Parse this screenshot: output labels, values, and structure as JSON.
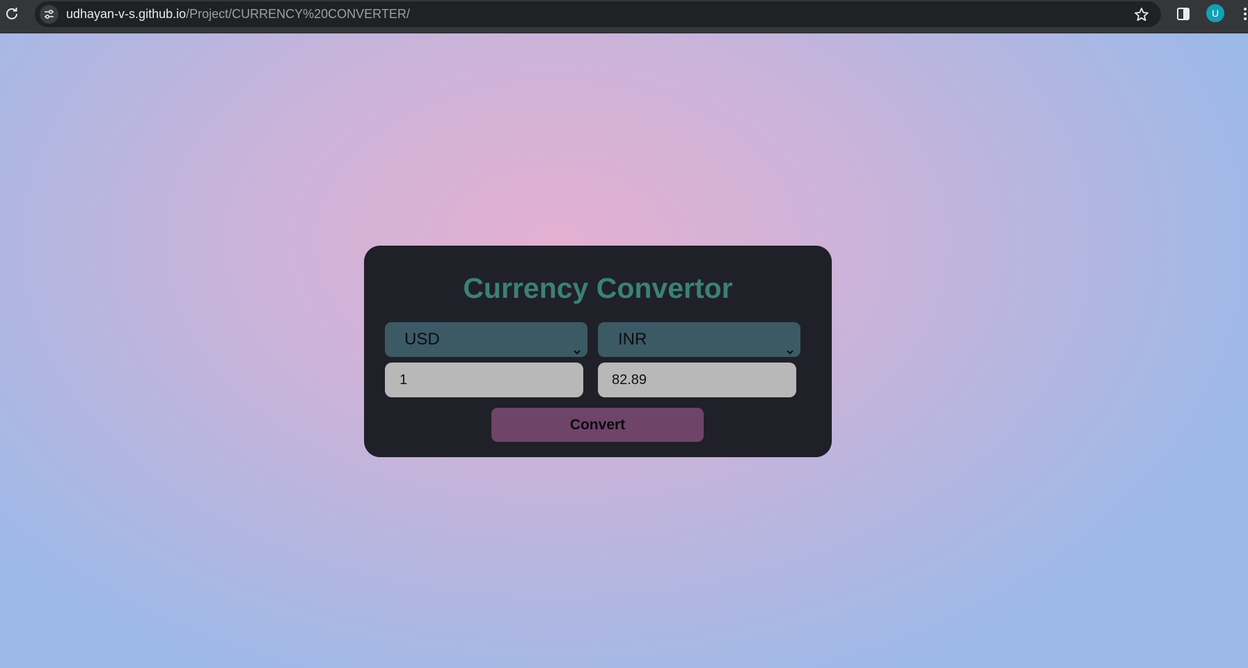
{
  "browser": {
    "url_host": "udhayan-v-s.github.io",
    "url_path": "/Project/CURRENCY%20CONVERTER/",
    "profile_initial": "U",
    "colors": {
      "chrome": "#35363a",
      "omnibox": "#202124",
      "avatar": "#13a0b5"
    }
  },
  "converter": {
    "title": "Currency Convertor",
    "from_currency": "USD",
    "to_currency": "INR",
    "from_amount": "1",
    "to_amount": "82.89",
    "convert_label": "Convert",
    "colors": {
      "card": "#202029",
      "title": "#3a8275",
      "select": "#3b5a64",
      "input": "#b8b8b8",
      "button": "#6f4469"
    }
  },
  "icons": [
    "reload-icon",
    "site-info-icon",
    "star-icon",
    "side-panel-icon",
    "more-menu-icon",
    "chevron-down-icon"
  ]
}
